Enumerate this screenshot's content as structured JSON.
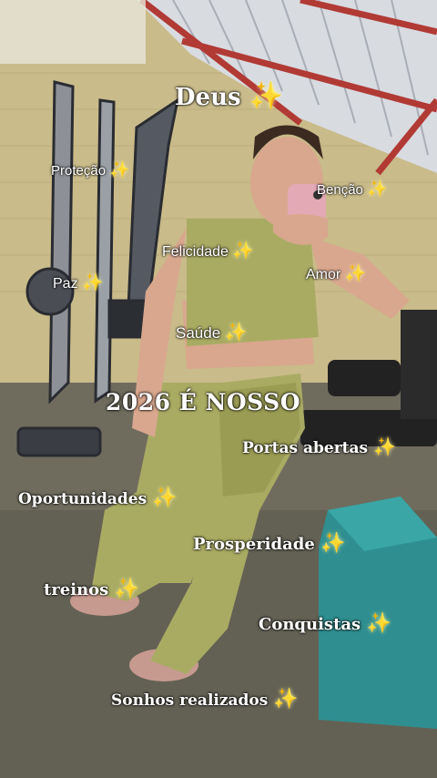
{
  "overlay_texts": {
    "deus": "Deus",
    "protecao": "Proteção",
    "bencao": "Benção",
    "felicidade": "Felicidade",
    "paz": "Paz",
    "amor": "Amor",
    "saude": "Saúde",
    "headline": "2026 É NOSSO",
    "portas_abertas": "Portas abertas",
    "oportunidades": "Oportunidades",
    "prosperidade": "Prosperidade",
    "treinos": "treinos",
    "conquistas": "Conquistas",
    "sonhos_realizados": "Sonhos realizados"
  },
  "sparkle_glyph": "✨",
  "colors": {
    "outfit": "#a9ab63",
    "sparkle": "#ffd84a",
    "wall": "#cdbf8c",
    "roof_beam": "#b13a35",
    "bench_teal": "#2f8f90"
  }
}
